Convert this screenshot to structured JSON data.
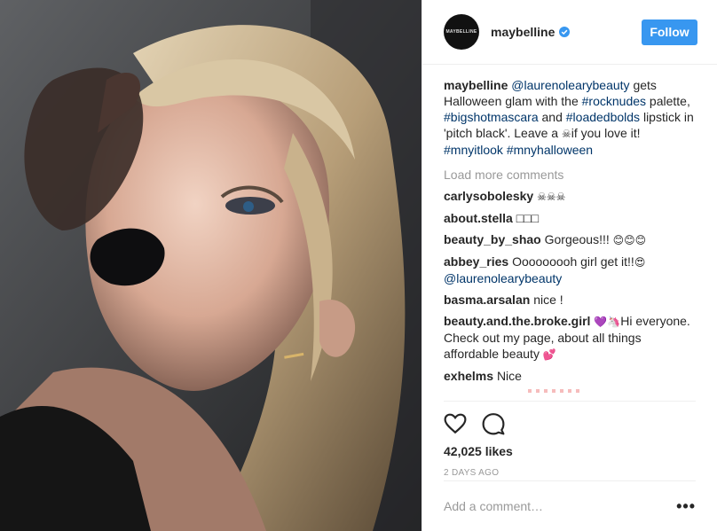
{
  "post": {
    "image_alt": "Woman with black lipstick and blond hair, hand raised to head",
    "header": {
      "avatar_text": "MAYBELLINE",
      "username": "maybelline",
      "verified": true,
      "follow_label": "Follow"
    },
    "caption": {
      "username": "maybelline",
      "t1": " ",
      "mention": "@laurenolearybeauty",
      "t2": " gets Halloween glam with the ",
      "tag1": "#rocknudes",
      "t3": " palette, ",
      "tag2": "#bigshotmascara",
      "t4": " and ",
      "tag3": "#loadedbolds",
      "t5": " lipstick in 'pitch black'. Leave a ",
      "emoji": "☠",
      "t6": "if you love it! ",
      "tag4": "#mnyitlook",
      "t7": " ",
      "tag5": "#mnyhalloween"
    },
    "load_more": "Load more comments",
    "comments": [
      {
        "user": "carlysobolesky",
        "text": "☠☠☠"
      },
      {
        "user": "about.stella",
        "text": "□□□"
      },
      {
        "user": "beauty_by_shao",
        "text": "Gorgeous!!! ",
        "emoji": "😊😊😊"
      },
      {
        "user": "abbey_ries",
        "text": "Ooooooooh girl get it!!",
        "emoji": "😍",
        "mention": "@laurenolearybeauty"
      },
      {
        "user": "basma.arsalan",
        "text": "nice !"
      },
      {
        "user": "beauty.and.the.broke.girl",
        "emoji": "💜🦄",
        "text": "Hi everyone. Check out my page, about all things affordable beauty ",
        "emoji2": "💕"
      },
      {
        "user": "exhelms",
        "text": "Nice"
      }
    ],
    "actions": {
      "likes": "42,025 likes",
      "timestamp": "2 DAYS AGO"
    },
    "add_comment": {
      "placeholder": "Add a comment…",
      "more_icon": "•••"
    },
    "colors": {
      "follow_button": "#3897f0",
      "link": "#003569",
      "muted": "#999999",
      "verified": "#3897f0"
    }
  }
}
